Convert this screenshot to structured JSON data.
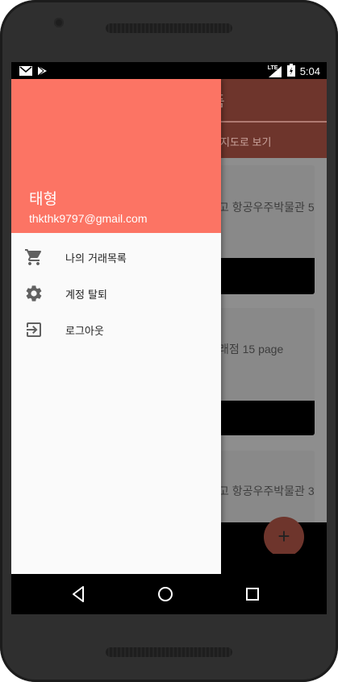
{
  "status_bar": {
    "time": "5:04",
    "network": "LTE",
    "notification_icons": [
      "gmail-icon",
      "play-store-icon"
    ],
    "status_icons": [
      "signal-icon",
      "battery-icon"
    ]
  },
  "background_app": {
    "toolbar_title": "품",
    "tab_label": "지도로 보기",
    "cards": [
      {
        "title": "고 항공우주박물관 5"
      },
      {
        "title": "래점 15 page"
      },
      {
        "title": "고 항공우주박물관 3"
      }
    ],
    "fab_label": "+"
  },
  "drawer": {
    "header_color": "#fc7464",
    "user_name": "태형",
    "user_email": "thkthk9797@gmail.com",
    "menu": [
      {
        "label": "나의 거래목록",
        "icon": "shopping-cart-icon"
      },
      {
        "label": "계정 탈퇴",
        "icon": "gear-icon"
      },
      {
        "label": "로그아웃",
        "icon": "logout-icon"
      }
    ]
  },
  "nav_bar": {
    "buttons": [
      "back-icon",
      "home-icon",
      "recents-icon"
    ]
  }
}
